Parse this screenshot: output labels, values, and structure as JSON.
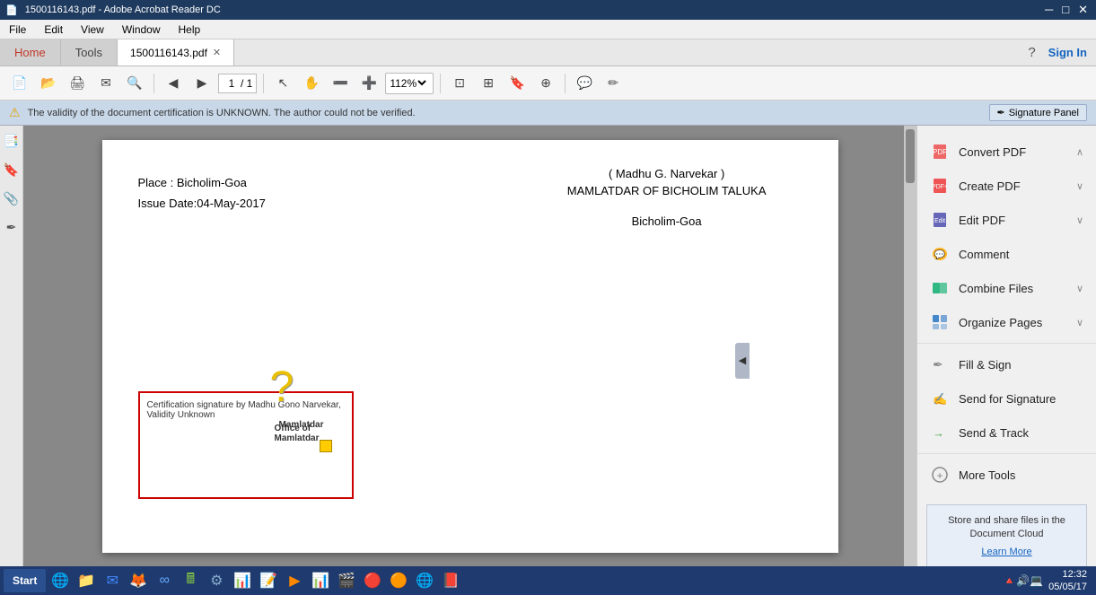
{
  "titleBar": {
    "title": "1500116143.pdf - Adobe Acrobat Reader DC",
    "controls": [
      "─",
      "□",
      "✕"
    ]
  },
  "menuBar": {
    "items": [
      "File",
      "Edit",
      "View",
      "Window",
      "Help"
    ]
  },
  "tabs": {
    "home": "Home",
    "tools": "Tools",
    "file": "1500116143.pdf",
    "signin": "Sign In",
    "help": "?"
  },
  "toolbar": {
    "zoomValue": "112%"
  },
  "notification": {
    "message": "The validity of the document certification is UNKNOWN. The author could not be verified.",
    "signaturePanel": "Signature Panel"
  },
  "pdf": {
    "placeText": "Place : Bicholim-Goa",
    "issueDateText": "Issue Date:04-May-2017",
    "authorLine1": "( Madhu G. Narvekar )",
    "authorLine2": "MAMLATDAR OF BICHOLIM TALUKA",
    "authorLine3": "Bicholim-Goa",
    "sigBoxText": "Certification signature by Madhu Gono Narvekar, Validity Unknown",
    "sigMamlatdar": "Mamlatdar",
    "sigOffice": "Office of Mamlatdar"
  },
  "rightSidebar": {
    "tools": [
      {
        "label": "Convert PDF",
        "chevron": "∧",
        "iconColor": "#e44"
      },
      {
        "label": "Create PDF",
        "chevron": "∨",
        "iconColor": "#e44"
      },
      {
        "label": "Edit PDF",
        "chevron": "∨",
        "iconColor": "#44a"
      },
      {
        "label": "Comment",
        "chevron": "",
        "iconColor": "#fa0"
      },
      {
        "label": "Combine Files",
        "chevron": "∨",
        "iconColor": "#0a6"
      },
      {
        "label": "Organize Pages",
        "chevron": "∨",
        "iconColor": "#48c"
      },
      {
        "label": "Fill & Sign",
        "chevron": "",
        "iconColor": "#888"
      },
      {
        "label": "Send for Signature",
        "chevron": "",
        "iconColor": "#48c"
      },
      {
        "label": "Send & Track",
        "chevron": "",
        "iconColor": "#4a4"
      },
      {
        "label": "More Tools",
        "chevron": "",
        "iconColor": "#888"
      }
    ],
    "bottomBox": {
      "text": "Store and share files in the Document Cloud",
      "linkText": "Learn More"
    }
  },
  "taskbar": {
    "startLabel": "Start",
    "time": "12:32",
    "date": "05/05/17"
  }
}
